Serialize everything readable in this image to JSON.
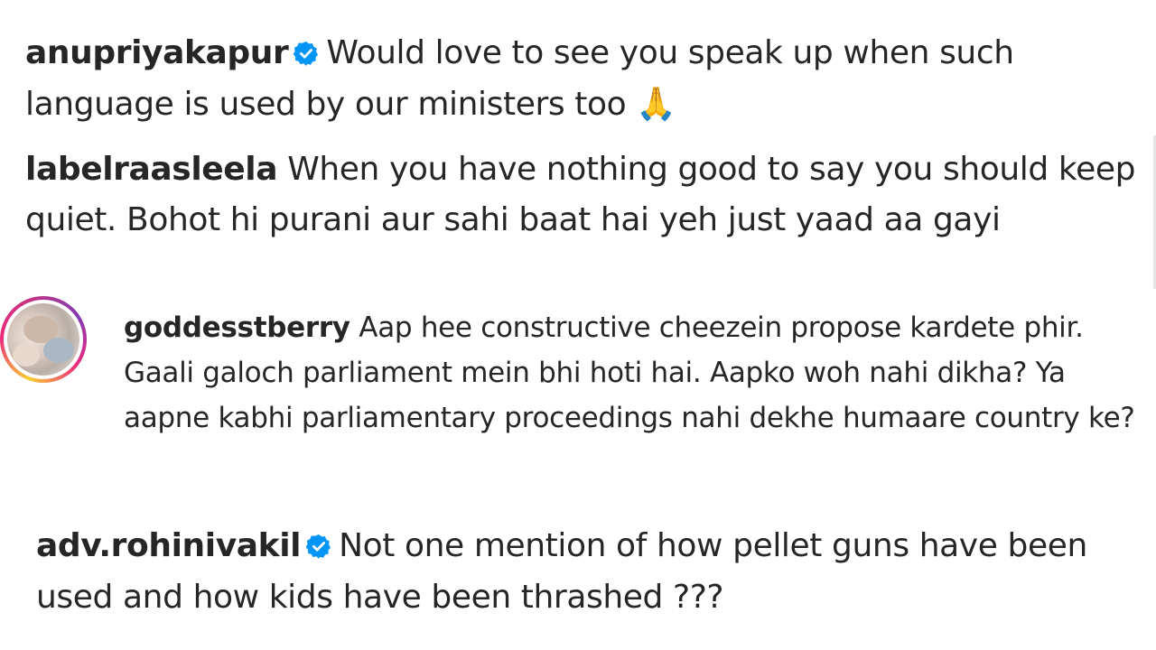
{
  "comments": [
    {
      "username": "anupriyakapur",
      "verified": true,
      "text": "Would love to see you speak up when such language is used by our ministers too 🙏"
    },
    {
      "username": "labelraasleela",
      "verified": false,
      "text": "When you have nothing good to say you should keep quiet. Bohot hi purani aur sahi baat hai yeh just yaad aa gayi"
    },
    {
      "username": "goddesstberry",
      "verified": false,
      "has_story_ring": true,
      "text": "Aap hee constructive cheezein propose kardete phir. Gaali galoch parliament mein bhi hoti hai. Aapko woh nahi dikha? Ya aapne kabhi parliamentary proceedings nahi dekhe humaare country ke?"
    },
    {
      "username": "adv.rohinivakil",
      "verified": true,
      "text": "Not one mention of how pellet guns have been used and how kids have been thrashed ???"
    }
  ],
  "colors": {
    "text": "#262626",
    "verified_badge": "#0095f6",
    "story_ring_start": "#f9ce34",
    "story_ring_mid": "#ee2a7b",
    "story_ring_end": "#833ab4"
  },
  "icons": {
    "verified": "verified-badge-icon"
  }
}
